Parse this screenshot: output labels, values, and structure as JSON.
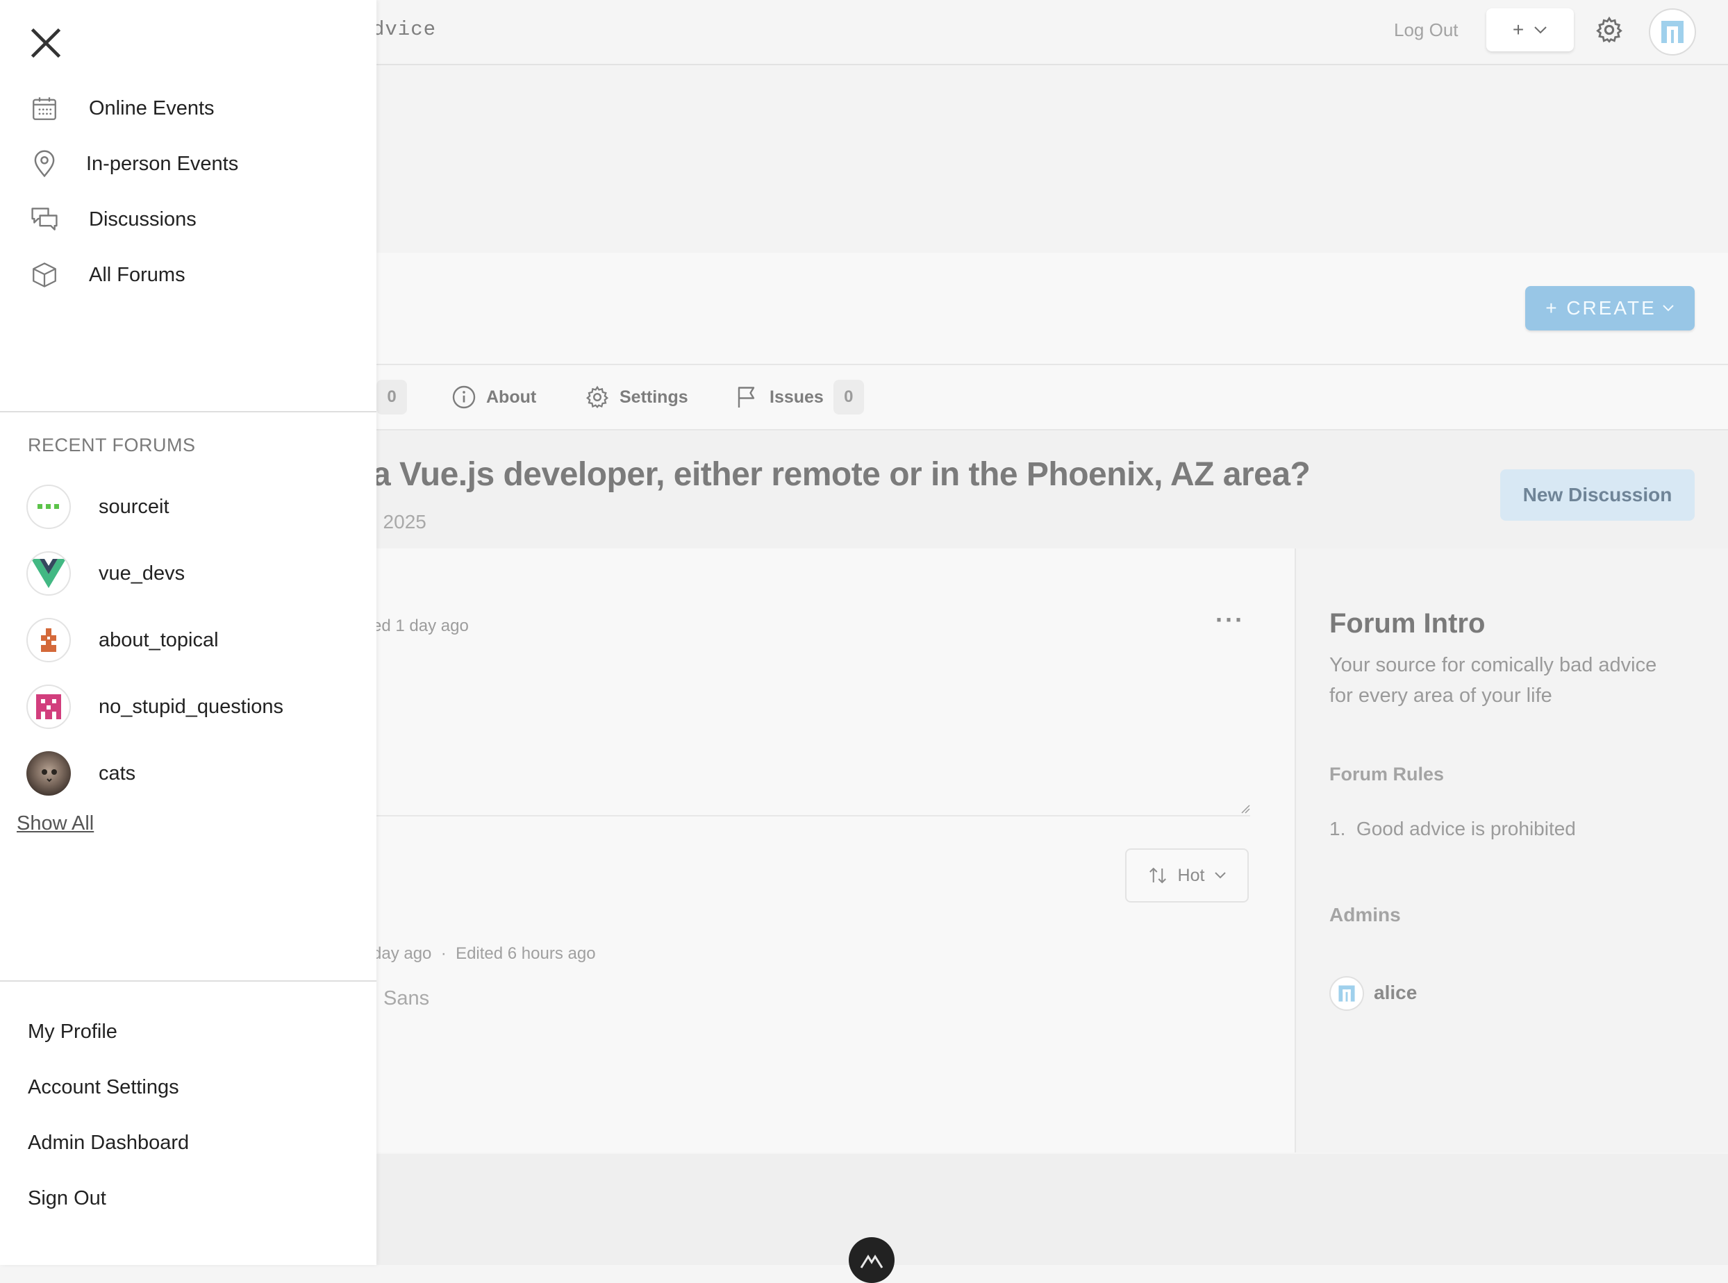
{
  "topbar": {
    "app_title": "dvice",
    "logout_label": "Log Out",
    "plus_label": "+"
  },
  "header": {
    "create_label": "+ CREATE"
  },
  "tabs": [
    {
      "label": "0",
      "is_count_only": true
    },
    {
      "label": "About"
    },
    {
      "label": "Settings"
    },
    {
      "label": "Issues",
      "count": "0"
    }
  ],
  "discussion": {
    "title": "a Vue.js developer, either remote or in the Phoenix, AZ area?",
    "date": ", 2025",
    "new_discussion_label": "New Discussion",
    "posted_meta": "ed 1 day ago",
    "more_label": "···",
    "sort_label": "Hot",
    "comment_meta": "day ago  ·  Edited 6 hours ago",
    "comment_text": "Sans"
  },
  "forum_sidebar": {
    "intro_title": "Forum Intro",
    "intro_text": "Your source for comically bad advice for every area of your life",
    "rules_title": "Forum Rules",
    "rules": [
      "1.  Good advice is prohibited"
    ],
    "admins_title": "Admins",
    "admins": [
      "alice"
    ]
  },
  "drawer": {
    "nav": [
      {
        "label": "Online Events",
        "icon": "calendar-icon"
      },
      {
        "label": "In-person Events",
        "icon": "location-pin-icon"
      },
      {
        "label": "Discussions",
        "icon": "chat-bubbles-icon"
      },
      {
        "label": "All Forums",
        "icon": "cube-icon"
      }
    ],
    "recent_title": "RECENT FORUMS",
    "recent_forums": [
      {
        "name": "sourceit"
      },
      {
        "name": "vue_devs"
      },
      {
        "name": "about_topical"
      },
      {
        "name": "no_stupid_questions"
      },
      {
        "name": "cats"
      }
    ],
    "show_all_label": "Show All",
    "account": [
      {
        "label": "My Profile"
      },
      {
        "label": "Account Settings"
      },
      {
        "label": "Admin Dashboard"
      },
      {
        "label": "Sign Out"
      }
    ]
  },
  "colors": {
    "create_button": "#98c6e6",
    "new_discussion_button": "#d8e8f4",
    "vue_green": "#42b883",
    "vue_dark": "#35495e",
    "about_topical_orange": "#d4693a",
    "no_stupid_pink": "#d23e7d",
    "sourceit_green": "#5cc34a"
  }
}
